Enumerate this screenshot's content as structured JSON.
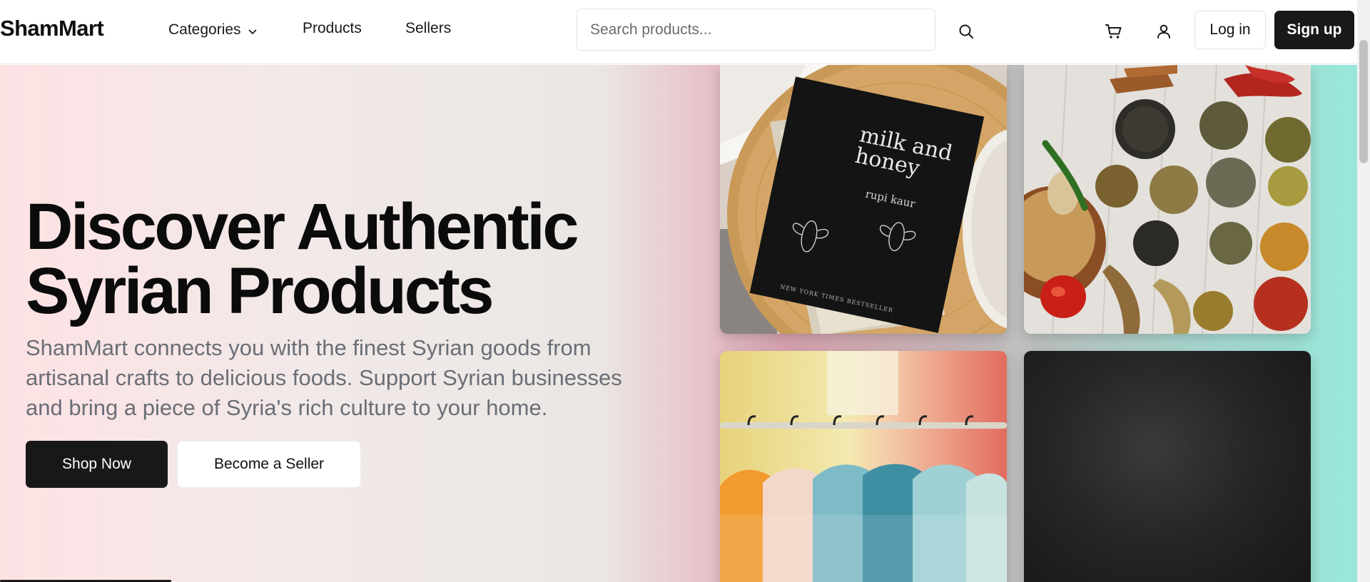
{
  "header": {
    "brand": "ShamMart",
    "nav": {
      "categories": "Categories",
      "products": "Products",
      "sellers": "Sellers"
    },
    "search": {
      "placeholder": "Search products..."
    },
    "login": "Log in",
    "signup": "Sign up"
  },
  "hero": {
    "title_line1": "Discover Authentic",
    "title_line2": "Syrian Products",
    "subtitle_line1": "ShamMart connects you with the finest Syrian goods from",
    "subtitle_line2": "artisanal crafts to delicious foods. Support Syrian businesses",
    "subtitle_line3": "and bring a piece of Syria's rich culture to your home.",
    "shop_button": "Shop Now",
    "seller_button": "Become a Seller"
  },
  "tiles": {
    "book": {
      "title_line1": "milk and",
      "title_line2": "honey",
      "author": "rupi kaur",
      "tagline": "NEW YORK TIMES BESTSELLER"
    }
  },
  "icons": {
    "chevron": "chevron-down-icon",
    "search": "search-icon",
    "cart": "cart-icon",
    "user": "user-icon"
  },
  "colors": {
    "primary_button": "#181818",
    "text_muted": "#6a6e76",
    "hero_left": "#fde2e4",
    "hero_right": "#98e7da"
  }
}
